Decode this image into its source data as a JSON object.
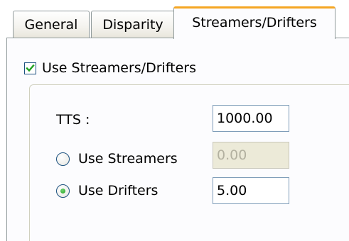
{
  "tabs": [
    {
      "label": "General",
      "active": false
    },
    {
      "label": "Disparity",
      "active": false
    },
    {
      "label": "Streamers/Drifters",
      "active": true
    }
  ],
  "options": {
    "use_checkbox_label": "Use Streamers/Drifters",
    "use_checkbox_checked": true
  },
  "fields": {
    "tts_label": "TTS :",
    "tts_value": "1000.00",
    "use_streamers_label": "Use Streamers",
    "streamers_value": "0.00",
    "use_drifters_label": "Use Drifters",
    "drifters_value": "5.00",
    "selected_mode": "Use Drifters"
  },
  "colors": {
    "active_tab_accent": "#f5a623",
    "checkmark": "#21a121",
    "radio_dot": "#21a121"
  }
}
